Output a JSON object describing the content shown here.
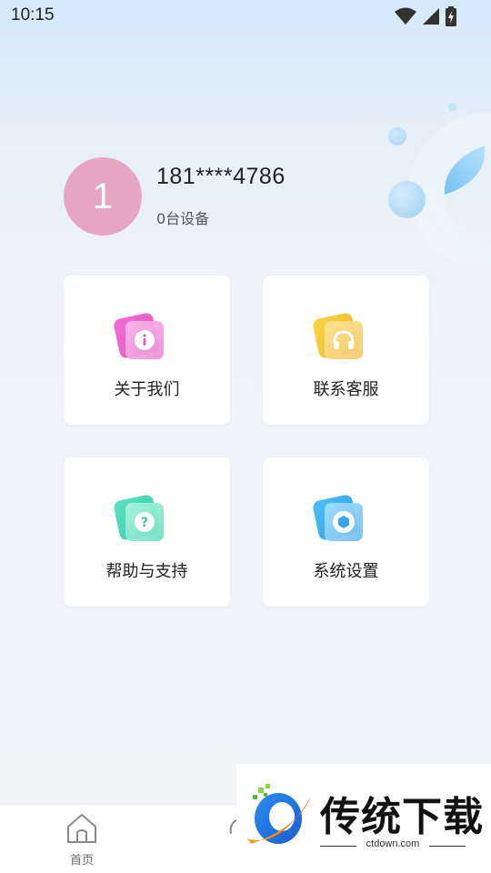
{
  "status_bar": {
    "time": "10:15",
    "icons": [
      "wifi-icon",
      "signal-icon",
      "battery-charging-icon"
    ]
  },
  "profile": {
    "avatar_initial": "1",
    "phone": "181****4786",
    "device_count": "0台设备"
  },
  "menu": [
    {
      "label": "关于我们",
      "icon": "info-icon",
      "color": "#e46ad0"
    },
    {
      "label": "联系客服",
      "icon": "headset-icon",
      "color": "#f2c44a"
    },
    {
      "label": "帮助与支持",
      "icon": "question-icon",
      "color": "#4fd6b8"
    },
    {
      "label": "系统设置",
      "icon": "hexagon-settings-icon",
      "color": "#3fb2f0"
    }
  ],
  "bottom_nav": {
    "items": [
      {
        "label": "首页",
        "icon": "home-icon"
      },
      {
        "label": "",
        "icon": "partial-icon"
      }
    ]
  },
  "watermark": {
    "title": "传统下载",
    "url": "ctdown.com"
  }
}
